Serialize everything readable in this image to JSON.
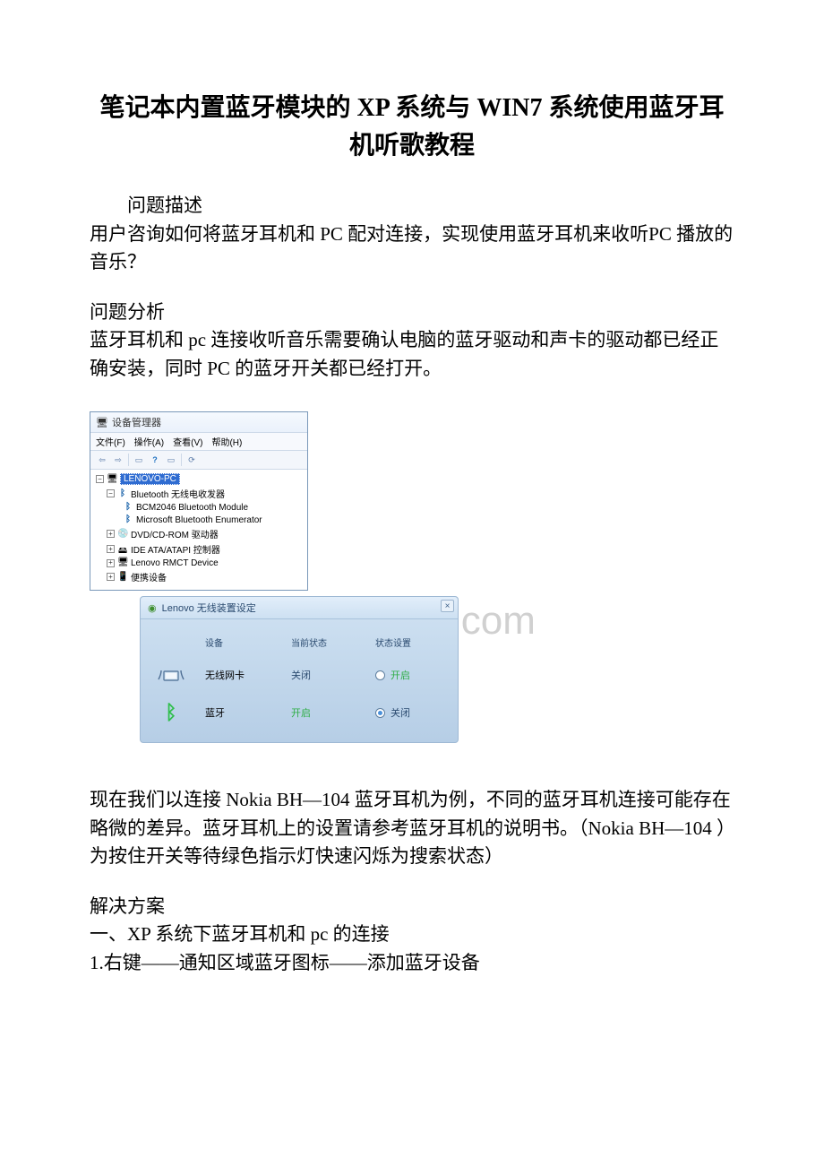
{
  "title": "笔记本内置蓝牙模块的 XP 系统与 WIN7 系统使用蓝牙耳机听歌教程",
  "sec_problem_desc_label": "问题描述",
  "sec_problem_desc": "用户咨询如何将蓝牙耳机和 PC 配对连接，实现使用蓝牙耳机来收听PC 播放的音乐？",
  "sec_analysis_label": "问题分析",
  "sec_analysis": "蓝牙耳机和 pc 连接收听音乐需要确认电脑的蓝牙驱动和声卡的驱动都已经正确安装，同时 PC 的蓝牙开关都已经打开。",
  "watermark": "www.bdocx.com",
  "devmgr": {
    "title": "设备管理器",
    "menu": {
      "file": "文件(F)",
      "action": "操作(A)",
      "view": "查看(V)",
      "help": "帮助(H)"
    },
    "tree": {
      "root": "LENOVO-PC",
      "bt_parent": "Bluetooth 无线电收发器",
      "bt_child1": "BCM2046 Bluetooth Module",
      "bt_child2": "Microsoft Bluetooth Enumerator",
      "dvd": "DVD/CD-ROM 驱动器",
      "ide": "IDE ATA/ATAPI 控制器",
      "rmct": "Lenovo RMCT Device",
      "portable": "便携设备"
    }
  },
  "lenovo": {
    "title": "Lenovo 无线装置设定",
    "close": "×",
    "cols": {
      "device": "设备",
      "status": "当前状态",
      "setting": "状态设置"
    },
    "wifi": {
      "name": "无线网卡",
      "status": "关闭",
      "action": "开启"
    },
    "bt": {
      "name": "蓝牙",
      "status": "开启",
      "action": "关闭"
    }
  },
  "para_example": "现在我们以连接 Nokia BH—104 蓝牙耳机为例，不同的蓝牙耳机连接可能存在略微的差异。蓝牙耳机上的设置请参考蓝牙耳机的说明书。（Nokia BH—104 ）为按住开关等待绿色指示灯快速闪烁为搜索状态）",
  "sec_solution_label": "解决方案",
  "sol_1": "一、XP 系统下蓝牙耳机和 pc 的连接",
  "sol_1_1": "1.右键——通知区域蓝牙图标——添加蓝牙设备"
}
